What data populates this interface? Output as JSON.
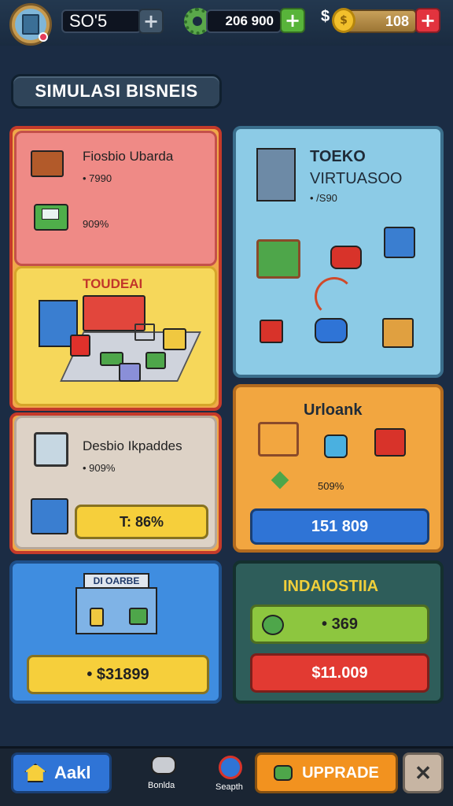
{
  "topbar": {
    "profile_value": "SO'5",
    "gear_value": "206 900",
    "dollar_symbol": "$",
    "coin_value": "108",
    "plus_label": "+"
  },
  "title": "SIMULASI BISNEIS",
  "panels": {
    "red": {
      "title": "Fiosbio Ubarda",
      "sub": "• 7990",
      "pct": "909%"
    },
    "yellow": {
      "title": "TOUDEAI"
    },
    "store_top": {
      "title": "TOEKO",
      "subtitle": "VIRTUASOO",
      "value": "• /S90"
    },
    "beige": {
      "title": "Desbio Ikpaddes",
      "sub": "• 909%",
      "button": "T: 86%"
    },
    "orange": {
      "title": "Urloank",
      "pct": "509%",
      "button": "151 809"
    },
    "blue": {
      "sign": "DI OARBE",
      "button": "• $31899"
    },
    "dark": {
      "title": "INDAIOSTIIA",
      "green_button": "• 369",
      "red_button": "$11.009"
    }
  },
  "bottom_nav": {
    "home_label": "Aakl",
    "mid1_label": "Bonlda",
    "mid2_label": "Seapth",
    "upgrade_label": "UPPRADE"
  },
  "colors": {
    "background": "#1b2c44",
    "red_panel": "#ef8a86",
    "yellow_panel": "#f6d75a",
    "sky_panel": "#8ccbe6",
    "orange_panel": "#f2a640",
    "blue_panel": "#3f8de0",
    "dark_panel": "#2e5d5a",
    "yellow_button": "#f6cf3b",
    "blue_button": "#2f74d6",
    "green_button": "#8dc63f",
    "red_button": "#e23a32",
    "upgrade_button": "#f2921f"
  }
}
